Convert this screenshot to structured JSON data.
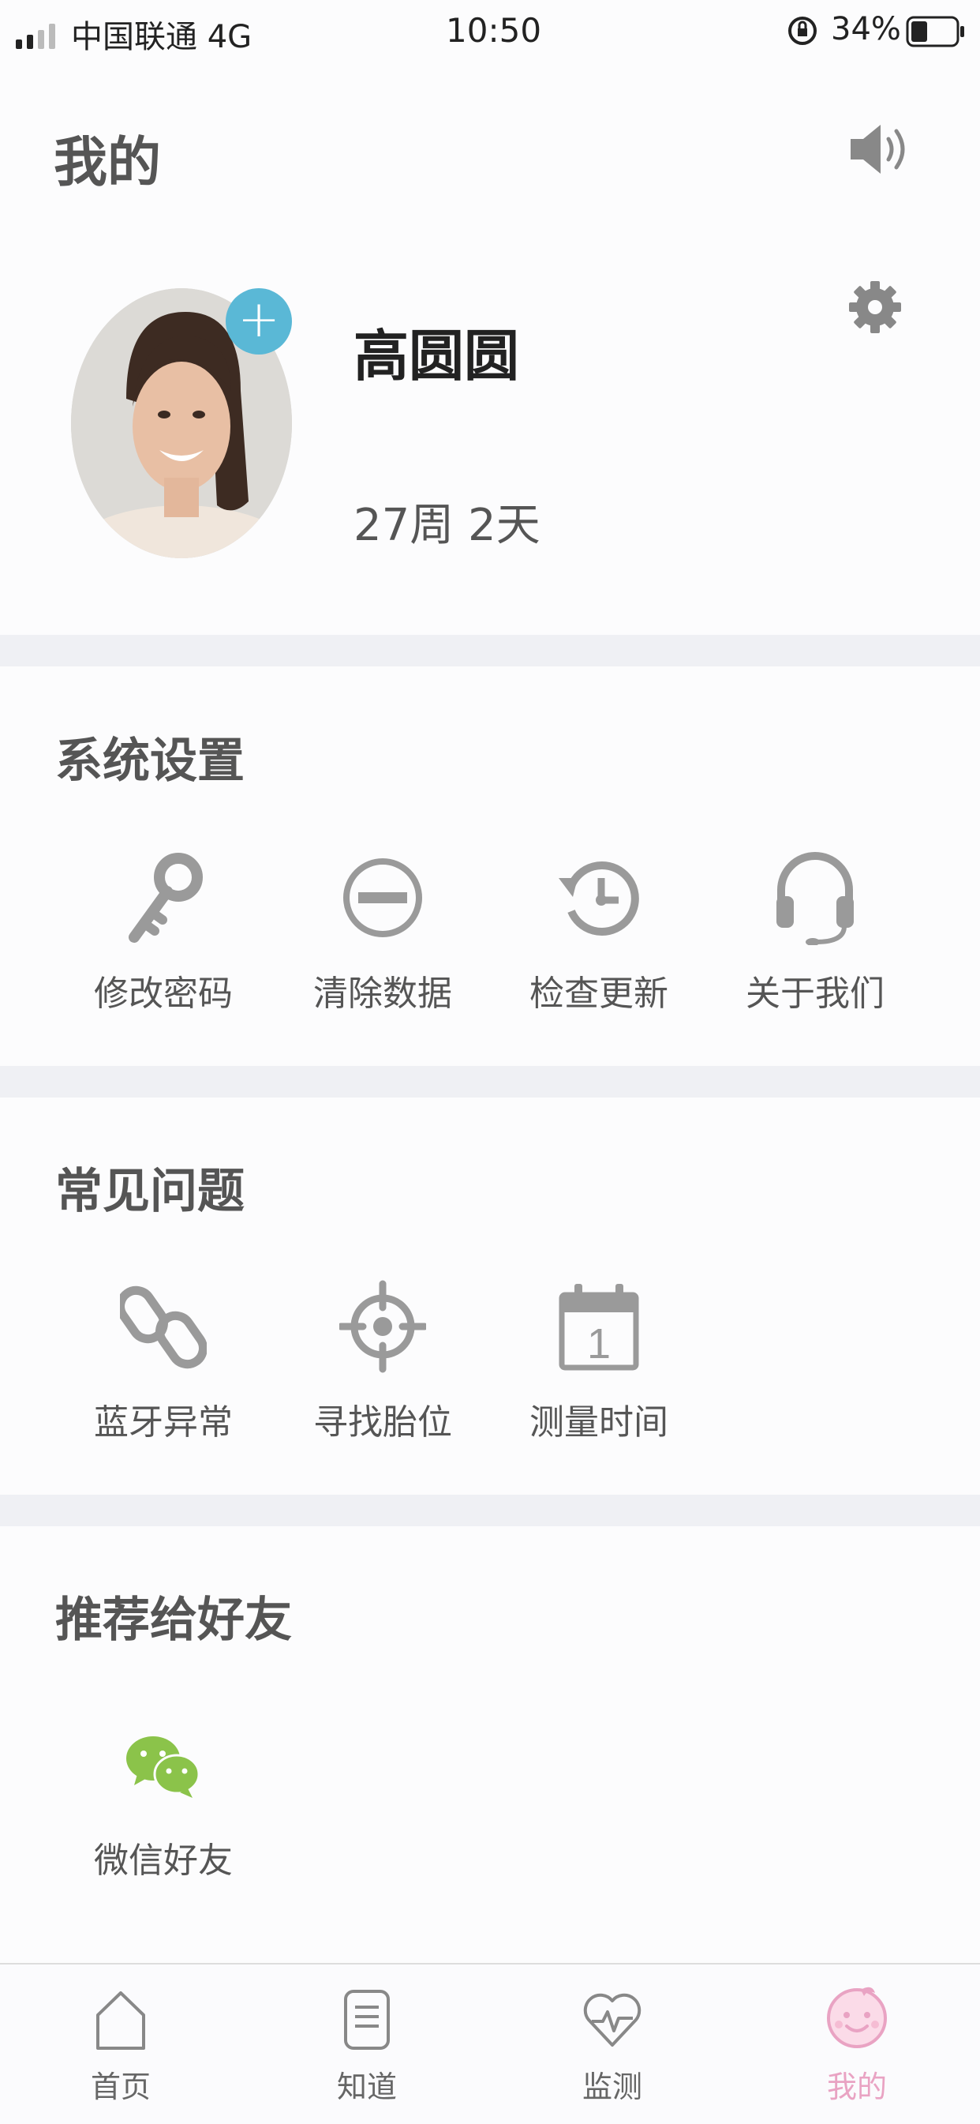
{
  "status_bar": {
    "carrier": "中国联通 4G",
    "time": "10:50",
    "battery": "34%"
  },
  "header": {
    "title": "我的"
  },
  "profile": {
    "name": "高圆圆",
    "pregnancy": "27周 2天",
    "add_label": "+"
  },
  "system_settings": {
    "title": "系统设置",
    "items": [
      {
        "label": "修改密码",
        "icon": "key-icon"
      },
      {
        "label": "清除数据",
        "icon": "minus-circle-icon"
      },
      {
        "label": "检查更新",
        "icon": "history-icon"
      },
      {
        "label": "关于我们",
        "icon": "headset-icon"
      }
    ]
  },
  "faq": {
    "title": "常见问题",
    "items": [
      {
        "label": "蓝牙异常",
        "icon": "link-icon"
      },
      {
        "label": "寻找胎位",
        "icon": "target-icon"
      },
      {
        "label": "测量时间",
        "icon": "calendar-icon",
        "calendar_day": "1"
      }
    ]
  },
  "recommend": {
    "title": "推荐给好友",
    "items": [
      {
        "label": "微信好友",
        "icon": "wechat-icon"
      }
    ]
  },
  "tabbar": {
    "items": [
      {
        "label": "首页",
        "icon": "home-icon"
      },
      {
        "label": "知道",
        "icon": "document-icon"
      },
      {
        "label": "监测",
        "icon": "heart-pulse-icon"
      },
      {
        "label": "我的",
        "icon": "baby-face-icon"
      }
    ],
    "active": "我的",
    "active_color": "#e9a3c3"
  },
  "colors": {
    "accent": "#5ab8d6",
    "wechat": "#8bc34a",
    "icon_gray": "#9a9a9a"
  }
}
